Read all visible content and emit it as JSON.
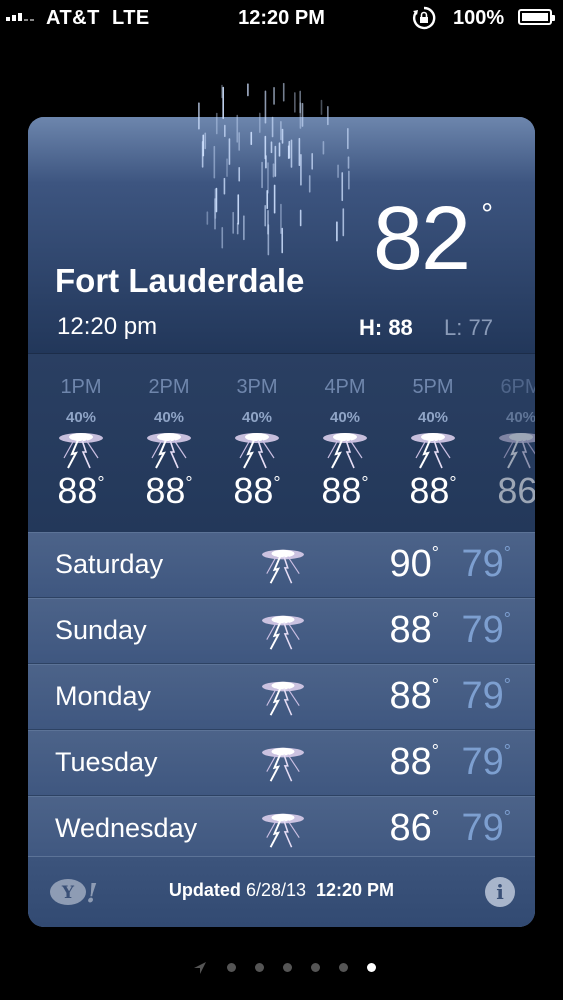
{
  "status_bar": {
    "carrier": "AT&T",
    "network": "LTE",
    "time": "12:20 PM",
    "battery": "100%",
    "battery_level": 1.0
  },
  "current": {
    "city": "Fort Lauderdale",
    "temp": "82",
    "local_time": "12:20 pm",
    "high": "H: 88",
    "low": "L: 77"
  },
  "hourly": [
    {
      "time": "1PM",
      "precip": "40%",
      "temp": "88",
      "icon": "thunderstorm-icon"
    },
    {
      "time": "2PM",
      "precip": "40%",
      "temp": "88",
      "icon": "thunderstorm-icon"
    },
    {
      "time": "3PM",
      "precip": "40%",
      "temp": "88",
      "icon": "thunderstorm-icon"
    },
    {
      "time": "4PM",
      "precip": "40%",
      "temp": "88",
      "icon": "thunderstorm-icon"
    },
    {
      "time": "5PM",
      "precip": "40%",
      "temp": "88",
      "icon": "thunderstorm-icon"
    },
    {
      "time": "6PM",
      "precip": "40%",
      "temp": "86",
      "icon": "thunderstorm-icon"
    }
  ],
  "daily": [
    {
      "day": "Saturday",
      "high": "90",
      "low": "79",
      "icon": "thunderstorm-icon"
    },
    {
      "day": "Sunday",
      "high": "88",
      "low": "79",
      "icon": "thunderstorm-icon"
    },
    {
      "day": "Monday",
      "high": "88",
      "low": "79",
      "icon": "thunderstorm-icon"
    },
    {
      "day": "Tuesday",
      "high": "88",
      "low": "79",
      "icon": "thunderstorm-icon"
    },
    {
      "day": "Wednesday",
      "high": "86",
      "low": "79",
      "icon": "thunderstorm-icon"
    }
  ],
  "footer": {
    "updated_label": "Updated",
    "updated_date": "6/28/13",
    "updated_time": "12:20 PM",
    "info": "i"
  },
  "pages": {
    "count": 6,
    "active": 6
  },
  "colors": {
    "low_temp": "#7d9fd0",
    "card": "#3b5378"
  }
}
